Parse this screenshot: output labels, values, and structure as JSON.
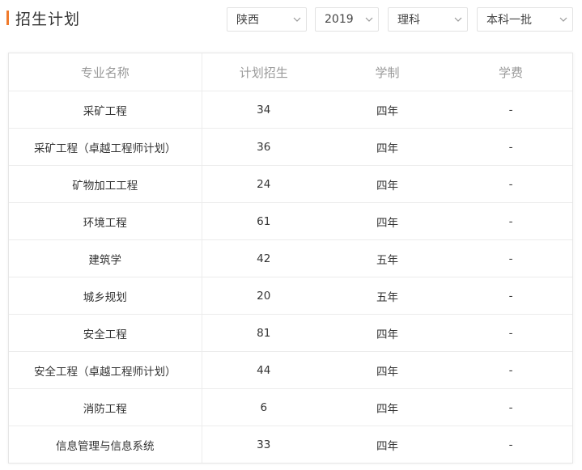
{
  "header": {
    "title": "招生计划"
  },
  "filters": {
    "province": "陕西",
    "year": "2019",
    "subject": "理科",
    "batch": "本科一批"
  },
  "table": {
    "columns": [
      "专业名称",
      "计划招生",
      "学制",
      "学费"
    ],
    "rows": [
      [
        "采矿工程",
        "34",
        "四年",
        "-"
      ],
      [
        "采矿工程（卓越工程师计划）",
        "36",
        "四年",
        "-"
      ],
      [
        "矿物加工工程",
        "24",
        "四年",
        "-"
      ],
      [
        "环境工程",
        "61",
        "四年",
        "-"
      ],
      [
        "建筑学",
        "42",
        "五年",
        "-"
      ],
      [
        "城乡规划",
        "20",
        "五年",
        "-"
      ],
      [
        "安全工程",
        "81",
        "四年",
        "-"
      ],
      [
        "安全工程（卓越工程师计划）",
        "44",
        "四年",
        "-"
      ],
      [
        "消防工程",
        "6",
        "四年",
        "-"
      ],
      [
        "信息管理与信息系统",
        "33",
        "四年",
        "-"
      ]
    ]
  },
  "colors": {
    "accent": "#f07b2c",
    "header_text": "#999999",
    "border": "#ececec"
  },
  "icons": {
    "dropdown": "chevron-down-icon"
  }
}
